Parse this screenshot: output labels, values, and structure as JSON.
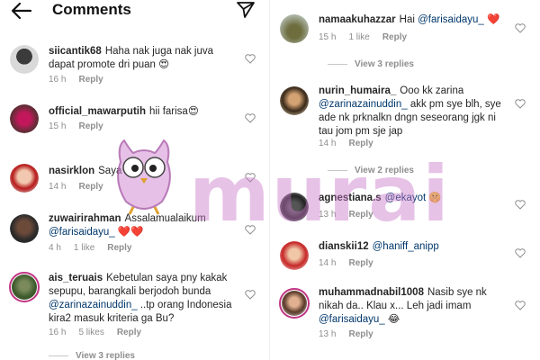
{
  "header": {
    "title": "Comments",
    "back_icon": "arrow-left-icon",
    "send_icon": "paper-plane-icon"
  },
  "watermark": {
    "text": "murai",
    "color": "#c878c8"
  },
  "left_comments": [
    {
      "user": "siicantik68",
      "text": "Haha nak juga nak juva dapat promote dri puan 😍",
      "time": "16 h",
      "likes": "",
      "reply": "Reply"
    },
    {
      "user": "official_mawarputih",
      "text": "hii farisa😍",
      "time": "15 h",
      "likes": "",
      "reply": "Reply"
    },
    {
      "user": "nasirklon",
      "text": "Saya ada",
      "time": "14 h",
      "likes": "",
      "reply": "Reply"
    },
    {
      "user": "zuwairirahman",
      "text": "Assalamualaikum",
      "mention": "@farisaidayu_",
      "after": " ❤️❤️",
      "time": "4 h",
      "likes": "1 like",
      "reply": "Reply"
    },
    {
      "user": "ais_teruais",
      "text": "Kebetulan saya pny kakak sepupu, barangkali berjodoh bunda",
      "mention": "@zarinazainuddin_",
      "after": " ..tp orang Indonesia kira2 masuk kriteria ga Bu?",
      "time": "16 h",
      "likes": "5 likes",
      "reply": "Reply",
      "view_replies": "View 3 replies"
    }
  ],
  "right_comments": [
    {
      "user": "namaakuhazzar",
      "text": "Hai",
      "mention": "@farisaidayu_",
      "after": " ❤️",
      "time": "15 h",
      "likes": "1 like",
      "reply": "Reply",
      "view_replies": "View 3 replies"
    },
    {
      "user": "nurin_humaira_",
      "text": "Ooo kk zarina",
      "mention": "@zarinazainuddin_",
      "after": "  akk pm sye blh, sye ade nk prknalkn dngn seseorang jgk ni tau jom pm sje jap",
      "time": "14 h",
      "likes": "",
      "reply": "Reply",
      "view_replies": "View 2 replies"
    },
    {
      "user": "agnestiana.s",
      "text": "",
      "mention": "@ekayot",
      "after": " 🤫",
      "time": "13 h",
      "likes": "",
      "reply": "Reply"
    },
    {
      "user": "dianskii12",
      "text": "",
      "mention": "@haniff_anipp",
      "after": "",
      "time": "14 h",
      "likes": "",
      "reply": "Reply"
    },
    {
      "user": "muhammadnabil1008",
      "text": "Nasib sye nk nikah da.. Klau x... Leh jadi imam",
      "mention": "@farisaidayu_",
      "after": " 😂",
      "time": "13 h",
      "likes": "",
      "reply": "Reply"
    }
  ]
}
